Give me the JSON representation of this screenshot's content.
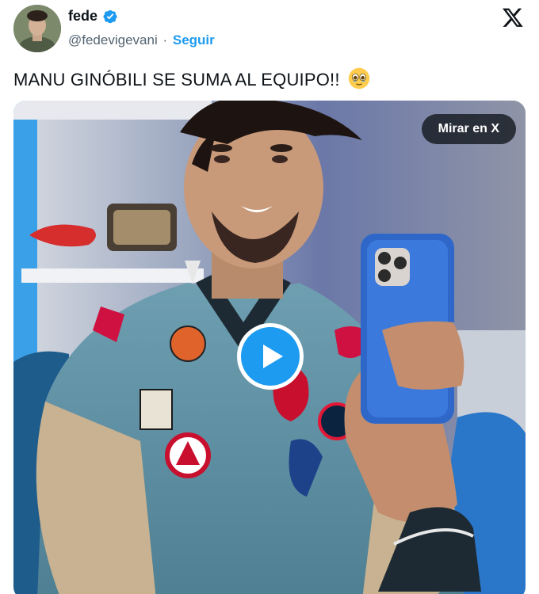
{
  "author": {
    "name": "fede",
    "handle": "@fedevigevani",
    "separator": "·",
    "follow_label": "Seguir",
    "verified": true,
    "avatar_icon": "avatar-photo"
  },
  "brand": {
    "logo_icon": "x-logo-icon"
  },
  "tweet": {
    "text": "MANU GINÓBILI SE SUMA AL EQUIPO!!",
    "emoji": "face-holding-back-tears"
  },
  "media": {
    "type": "video",
    "watch_label": "Mirar en X",
    "play_icon": "play-icon"
  },
  "colors": {
    "accent": "#1d9bf0",
    "text": "#0f1419",
    "secondary": "#536471",
    "overlay": "#0f1419"
  }
}
